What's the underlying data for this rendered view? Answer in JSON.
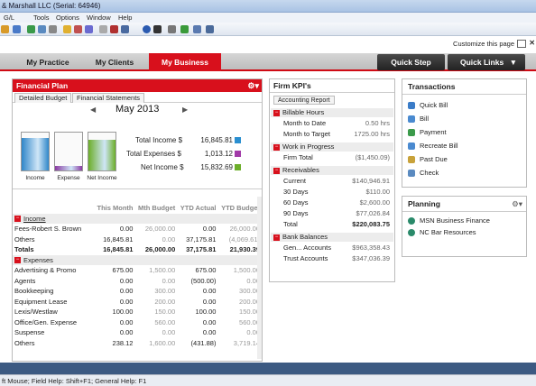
{
  "window": {
    "title": "& Marshall LLC (Serial: 64946)"
  },
  "menu": [
    "G/L",
    "Tools",
    "Options",
    "Window",
    "Help"
  ],
  "customize": {
    "label": "Customize this page"
  },
  "nav": {
    "tabs": [
      "My Practice",
      "My Clients",
      "My Business"
    ],
    "active": "My Business",
    "quick_step": "Quick Step",
    "quick_links": "Quick Links"
  },
  "financial_plan": {
    "title": "Financial Plan",
    "subtabs": [
      "Detailed Budget",
      "Financial Statements"
    ],
    "month": "May 2013",
    "gauges": [
      {
        "label": "Income",
        "fill": 0.85,
        "color": "#2f86c9"
      },
      {
        "label": "Expense",
        "fill": 0.12,
        "color": "#8a3aa2"
      },
      {
        "label": "Net Income",
        "fill": 0.8,
        "color": "#6cae2a"
      }
    ],
    "kpis": [
      {
        "label": "Total Income $",
        "value": "16,845.81",
        "color": "#2a8fd0"
      },
      {
        "label": "Total Expenses $",
        "value": "1,013.12",
        "color": "#a23aa8"
      },
      {
        "label": "Net Income $",
        "value": "15,832.69",
        "color": "#6cae2a"
      }
    ],
    "columns": [
      "This Month",
      "Mth Budget",
      "YTD Actual",
      "YTD Budget"
    ],
    "income": {
      "label": "Income",
      "rows": [
        {
          "name": "Fees-Robert S. Brown",
          "v": [
            "0.00",
            "26,000.00",
            "0.00",
            "26,000.00"
          ]
        },
        {
          "name": "Others",
          "v": [
            "16,845.81",
            "0.00",
            "37,175.81",
            "(4,069.61)"
          ]
        }
      ],
      "totals": {
        "name": "Totals",
        "v": [
          "16,845.81",
          "26,000.00",
          "37,175.81",
          "21,930.39"
        ]
      }
    },
    "expenses": {
      "label": "Expenses",
      "rows": [
        {
          "name": "Advertising & Promo",
          "v": [
            "675.00",
            "1,500.00",
            "675.00",
            "1,500.00"
          ]
        },
        {
          "name": "Agents",
          "v": [
            "0.00",
            "0.00",
            "(500.00)",
            "0.00"
          ]
        },
        {
          "name": "Bookkeeping",
          "v": [
            "0.00",
            "300.00",
            "0.00",
            "300.00"
          ]
        },
        {
          "name": "Equipment Lease",
          "v": [
            "0.00",
            "200.00",
            "0.00",
            "200.00"
          ]
        },
        {
          "name": "Lexis/Westlaw",
          "v": [
            "100.00",
            "150.00",
            "100.00",
            "150.00"
          ]
        },
        {
          "name": "Office/Gen. Expense",
          "v": [
            "0.00",
            "560.00",
            "0.00",
            "560.00"
          ]
        },
        {
          "name": "Suspense",
          "v": [
            "0.00",
            "0.00",
            "0.00",
            "0.00"
          ]
        },
        {
          "name": "Others",
          "v": [
            "238.12",
            "1,600.00",
            "(431.88)",
            "3,719.14"
          ]
        }
      ]
    }
  },
  "firm_kpi": {
    "title": "Firm KPI's",
    "tab": "Accounting Report",
    "groups": [
      {
        "label": "Billable Hours",
        "rows": [
          {
            "name": "Month to Date",
            "value": "0.50 hrs"
          },
          {
            "name": "Month to Target",
            "value": "1725.00 hrs"
          }
        ]
      },
      {
        "label": "Work in Progress",
        "rows": [
          {
            "name": "Firm Total",
            "value": "($1,450.09)"
          }
        ]
      },
      {
        "label": "Receivables",
        "rows": [
          {
            "name": "Current",
            "value": "$140,946.91"
          },
          {
            "name": "30 Days",
            "value": "$110.00"
          },
          {
            "name": "60 Days",
            "value": "$2,600.00"
          },
          {
            "name": "90 Days",
            "value": "$77,026.84"
          },
          {
            "name": "Total",
            "value": "$220,083.75"
          }
        ]
      },
      {
        "label": "Bank Balances",
        "rows": [
          {
            "name": "Gen... Accounts",
            "value": "$963,358.43"
          },
          {
            "name": "Trust Accounts",
            "value": "$347,036.39"
          }
        ]
      }
    ]
  },
  "transactions": {
    "title": "Transactions",
    "items": [
      {
        "label": "Quick Bill",
        "icon": "quick-bill-icon",
        "color": "#3a7cc8"
      },
      {
        "label": "Bill",
        "icon": "bill-icon",
        "color": "#4a8ad0"
      },
      {
        "label": "Payment",
        "icon": "payment-icon",
        "color": "#3b9a4a"
      },
      {
        "label": "Recreate Bill",
        "icon": "recreate-bill-icon",
        "color": "#4a8ad0"
      },
      {
        "label": "Past Due",
        "icon": "past-due-icon",
        "color": "#c8a23a"
      },
      {
        "label": "Check",
        "icon": "check-icon",
        "color": "#5a8ac0"
      }
    ]
  },
  "planning": {
    "title": "Planning",
    "items": [
      {
        "label": "MSN Business Finance",
        "icon": "msn-icon"
      },
      {
        "label": "NC Bar Resources",
        "icon": "nc-bar-icon"
      }
    ]
  },
  "statusbar": {
    "text": "ft Mouse; Field Help: Shift+F1; General Help: F1"
  }
}
